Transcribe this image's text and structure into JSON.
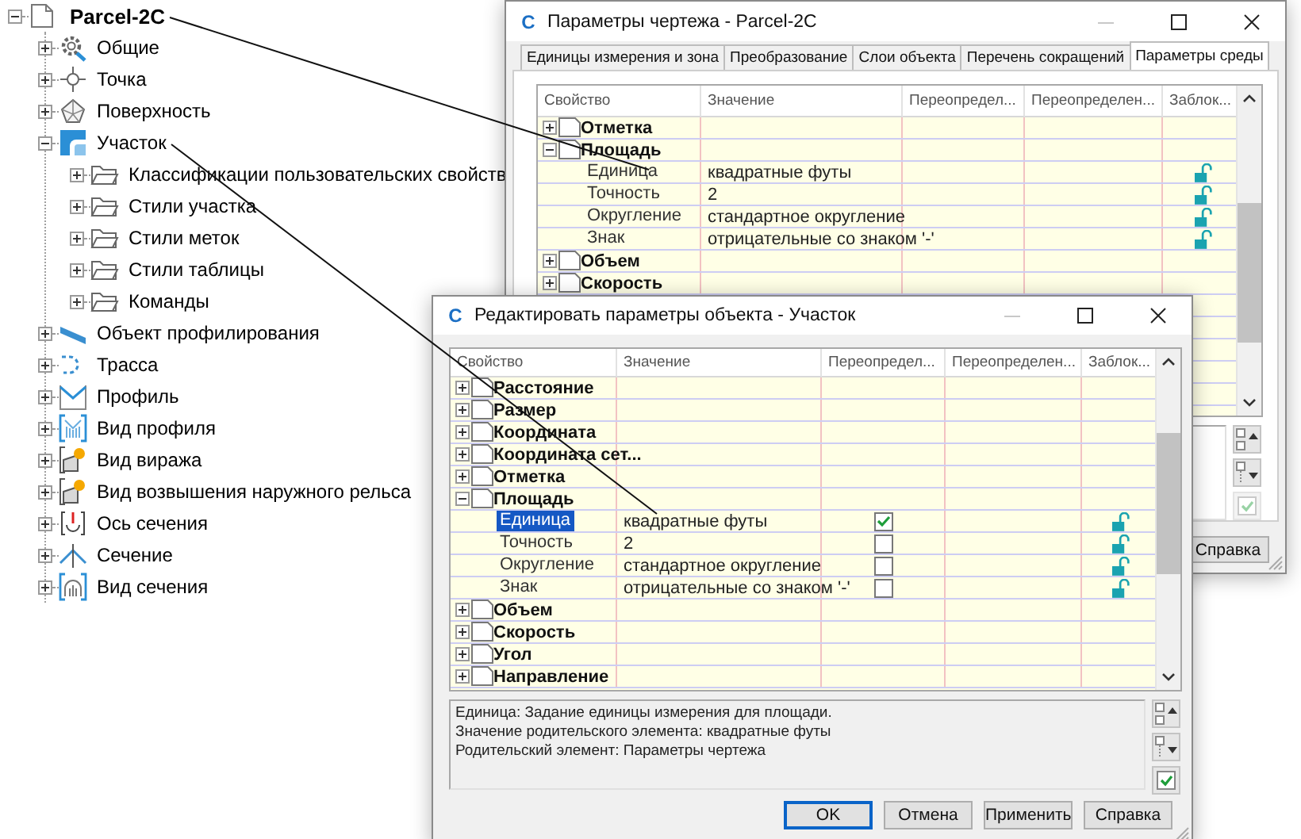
{
  "tree": {
    "label": "Parcel-2C",
    "kind": "drawing",
    "expanded": true,
    "children": [
      {
        "label": "Общие",
        "kind": "settings",
        "expanded": false
      },
      {
        "label": "Точка",
        "kind": "point",
        "expanded": false
      },
      {
        "label": "Поверхность",
        "kind": "surface",
        "expanded": false
      },
      {
        "label": "Участок",
        "kind": "parcel",
        "expanded": true,
        "children": [
          {
            "label": "Классификации пользовательских свойств",
            "kind": "folder",
            "expanded": false
          },
          {
            "label": "Стили участка",
            "kind": "folder",
            "expanded": false
          },
          {
            "label": "Стили меток",
            "kind": "folder",
            "expanded": false
          },
          {
            "label": "Стили таблицы",
            "kind": "folder",
            "expanded": false
          },
          {
            "label": "Команды",
            "kind": "folder",
            "expanded": false
          }
        ]
      },
      {
        "label": "Объект профилирования",
        "kind": "grading",
        "expanded": false
      },
      {
        "label": "Трасса",
        "kind": "alignment",
        "expanded": false
      },
      {
        "label": "Профиль",
        "kind": "profile",
        "expanded": false
      },
      {
        "label": "Вид профиля",
        "kind": "profile-view",
        "expanded": false
      },
      {
        "label": "Вид виража",
        "kind": "superelevation-view",
        "expanded": false
      },
      {
        "label": "Вид возвышения наружного рельса",
        "kind": "cant-view",
        "expanded": false
      },
      {
        "label": "Ось сечения",
        "kind": "sample-line",
        "expanded": false
      },
      {
        "label": "Сечение",
        "kind": "section",
        "expanded": false
      },
      {
        "label": "Вид сечения",
        "kind": "section-view",
        "expanded": false
      }
    ]
  },
  "settings_dialog": {
    "logo": "C",
    "title": "Параметры чертежа - Parcel-2C",
    "tabs": [
      {
        "label": "Единицы измерения и зона",
        "selected": false
      },
      {
        "label": "Преобразование",
        "selected": false
      },
      {
        "label": "Слои объекта",
        "selected": false
      },
      {
        "label": "Перечень сокращений",
        "selected": false
      },
      {
        "label": "Параметры среды",
        "selected": true
      }
    ],
    "columns": [
      "Свойство",
      "Значение",
      "Переопредел...",
      "Переопределен...",
      "Заблок..."
    ],
    "rows": [
      {
        "kind": "group",
        "label": "Отметка",
        "expanded": false
      },
      {
        "kind": "group",
        "label": "Площадь",
        "expanded": true
      },
      {
        "kind": "property",
        "label": "Единица",
        "value": "квадратные футы",
        "locked": false
      },
      {
        "kind": "property",
        "label": "Точность",
        "value": "2",
        "locked": false
      },
      {
        "kind": "property",
        "label": "Округление",
        "value": "стандартное округление",
        "locked": false
      },
      {
        "kind": "property",
        "label": "Знак",
        "value": "отрицательные со знаком '-'",
        "locked": false
      },
      {
        "kind": "group",
        "label": "Объем",
        "expanded": false
      },
      {
        "kind": "group",
        "label": "Скорость",
        "expanded": false
      }
    ],
    "side_buttons": [
      {
        "kind": "collapse-all",
        "disabled": false
      },
      {
        "kind": "expand-all",
        "disabled": false
      },
      {
        "kind": "check",
        "disabled": true
      }
    ],
    "buttons": [
      {
        "label": "Справка",
        "focused": false
      }
    ]
  },
  "object_dialog": {
    "logo": "C",
    "title": "Редактировать параметры объекта - Участок",
    "columns": [
      "Свойство",
      "Значение",
      "Переопредел...",
      "Переопределен...",
      "Заблок..."
    ],
    "rows": [
      {
        "kind": "group",
        "label": "Расстояние",
        "expanded": false,
        "selected": false
      },
      {
        "kind": "group",
        "label": "Размер",
        "expanded": false,
        "selected": false
      },
      {
        "kind": "group",
        "label": "Координата",
        "expanded": false,
        "selected": false
      },
      {
        "kind": "group",
        "label": "Координата сет...",
        "expanded": false,
        "selected": false
      },
      {
        "kind": "group",
        "label": "Отметка",
        "expanded": false,
        "selected": false
      },
      {
        "kind": "group",
        "label": "Площадь",
        "expanded": true,
        "selected": false
      },
      {
        "kind": "property",
        "label": "Единица",
        "value": "квадратные футы",
        "override": true,
        "locked": false,
        "selected": true
      },
      {
        "kind": "property",
        "label": "Точность",
        "value": "2",
        "override": false,
        "locked": false,
        "selected": false
      },
      {
        "kind": "property",
        "label": "Округление",
        "value": "стандартное округление",
        "override": false,
        "locked": false,
        "selected": false
      },
      {
        "kind": "property",
        "label": "Знак",
        "value": "отрицательные со знаком '-'",
        "override": false,
        "locked": false,
        "selected": false
      },
      {
        "kind": "group",
        "label": "Объем",
        "expanded": false,
        "selected": false
      },
      {
        "kind": "group",
        "label": "Скорость",
        "expanded": false,
        "selected": false
      },
      {
        "kind": "group",
        "label": "Угол",
        "expanded": false,
        "selected": false
      },
      {
        "kind": "group",
        "label": "Направление",
        "expanded": false,
        "selected": false
      }
    ],
    "description": [
      "Единица: Задание единицы измерения для площади.",
      "Значение родительского элемента: квадратные футы",
      "Родительский элемент: Параметры чертежа"
    ],
    "side_buttons": [
      {
        "kind": "collapse-all",
        "disabled": false
      },
      {
        "kind": "expand-all",
        "disabled": false
      },
      {
        "kind": "check",
        "disabled": false
      }
    ],
    "buttons": [
      {
        "label": "OK",
        "focused": true
      },
      {
        "label": "Отмена",
        "focused": false
      },
      {
        "label": "Применить",
        "focused": false
      },
      {
        "label": "Справка",
        "focused": false
      }
    ]
  }
}
